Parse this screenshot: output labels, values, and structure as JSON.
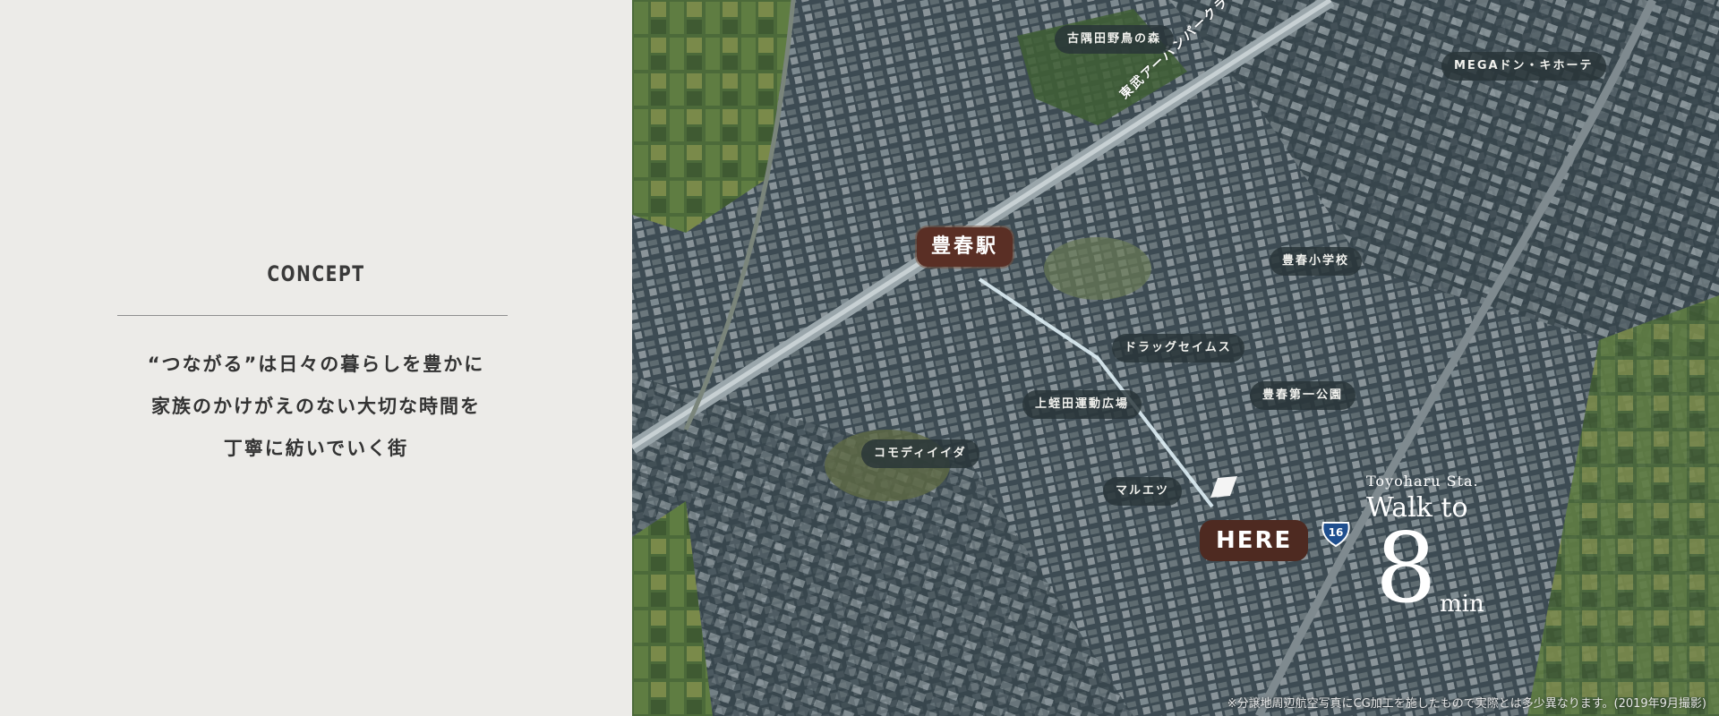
{
  "concept": {
    "heading": "CONCEPT",
    "lines": [
      "“つながる”は日々の暮らしを豊かに",
      "家族のかけがえのない大切な時間を",
      "丁寧に紡いでいく街"
    ]
  },
  "map": {
    "station": "豊春駅",
    "here": "HERE",
    "railway": "東武アーバンパークライン",
    "route_number": "16",
    "landmarks": {
      "forest": "古隅田野鳥の森",
      "mega": "MEGAドン・キホーテ",
      "school": "豊春小学校",
      "drug": "ドラッグセイムス",
      "park": "豊春第一公園",
      "ground": "上蛭田運動広場",
      "comodi": "コモディイイダ",
      "maruetsu": "マルエツ"
    },
    "walk": {
      "station_en": "Toyoharu Sta.",
      "walk_to": "Walk to",
      "minutes": "8",
      "unit": "min"
    },
    "note": "※分譲地周辺航空写真にCG加工を施したもので実際とは多少異なります。(2019年9月撮影)"
  },
  "colors": {
    "panel_bg": "#ecebe8",
    "badge_brown": "#5a2f25",
    "pill_dark": "#283438",
    "route_blue": "#1f4f8f"
  }
}
